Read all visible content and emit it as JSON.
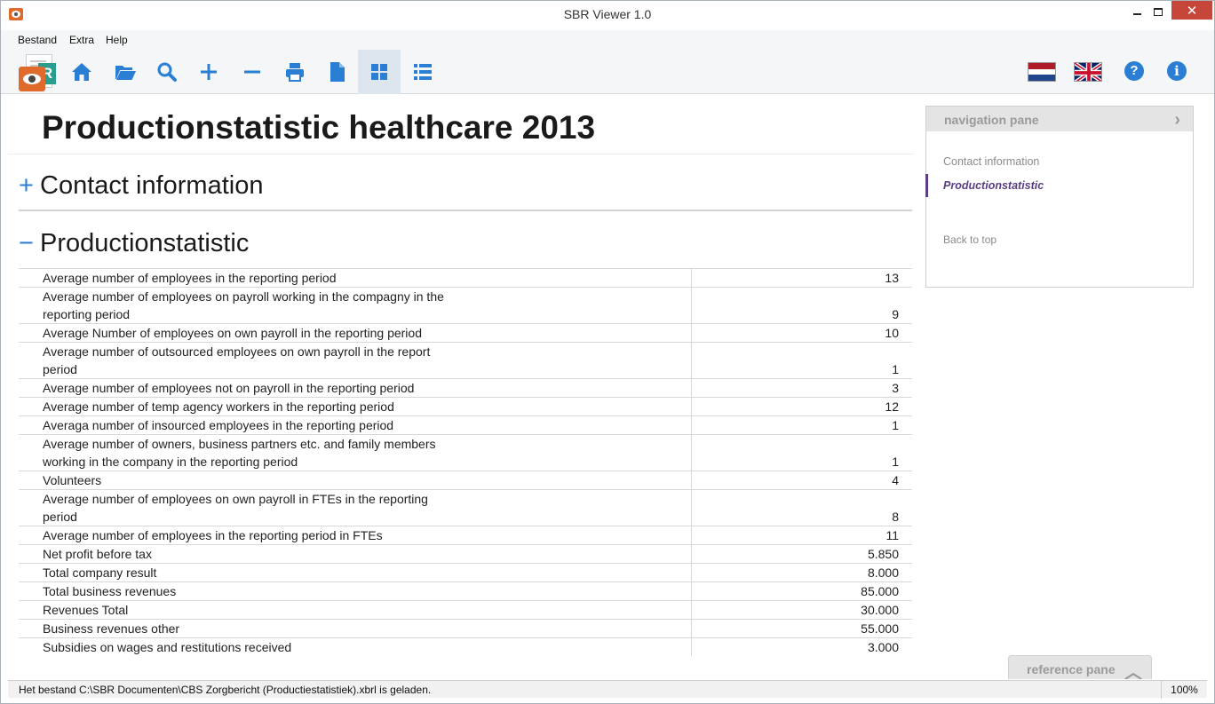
{
  "window": {
    "title": "SBR Viewer 1.0",
    "close_glyph": "✕"
  },
  "menu": [
    "Bestand",
    "Extra",
    "Help"
  ],
  "toolbar": {
    "icons": [
      "home-icon",
      "open-folder-icon",
      "search-icon",
      "zoom-in-icon",
      "zoom-out-icon",
      "print-icon",
      "document-icon",
      "grid-view-icon",
      "list-view-icon"
    ],
    "active": "grid-view-icon",
    "right_icons": [
      "dutch-flag-icon",
      "uk-flag-icon",
      "help-icon",
      "info-icon"
    ],
    "help_glyph": "?",
    "info_glyph": "i"
  },
  "report": {
    "title": "Productionstatistic healthcare 2013",
    "sections": [
      {
        "sign": "+",
        "title": "Contact information"
      },
      {
        "sign": "−",
        "title": "Productionstatistic"
      }
    ],
    "rows": [
      {
        "label": "Average number of employees in the reporting period",
        "value": "13"
      },
      {
        "label": "Average number of employees on payroll working in the compagny in the reporting period",
        "value": "9"
      },
      {
        "label": "Average Number of employees on own payroll in the reporting period",
        "value": "10"
      },
      {
        "label": "Average number of outsourced employees on own payroll in the report period",
        "value": "1"
      },
      {
        "label": "Average number of employees not on payroll in the reporting period",
        "value": "3"
      },
      {
        "label": "Average number of temp agency workers in the reporting period",
        "value": "12"
      },
      {
        "label": "Averaga number of insourced employees in the reporting period",
        "value": "1"
      },
      {
        "label": "Average number of owners, business partners etc. and family members working in the company in the reporting period",
        "value": "1"
      },
      {
        "label": "Volunteers",
        "value": "4"
      },
      {
        "label": "Average number of employees on own payroll in FTEs in the reporting period",
        "value": "8"
      },
      {
        "label": "Average number of employees in the reporting period in FTEs",
        "value": "11"
      },
      {
        "label": "Net profit before tax",
        "value": "5.850"
      },
      {
        "label": "Total company result",
        "value": "8.000"
      },
      {
        "label": "Total business revenues",
        "value": "85.000"
      },
      {
        "label": "Revenues Total",
        "value": "30.000"
      },
      {
        "label": "Business revenues other",
        "value": "55.000"
      },
      {
        "label": "Subsidies on wages and restitutions received",
        "value": "3.000"
      }
    ]
  },
  "navigation_pane": {
    "title": "navigation pane",
    "chevron": "›",
    "items": [
      "Contact information",
      "Productionstatistic"
    ],
    "active_item": "Productionstatistic",
    "back_to_top": "Back to top"
  },
  "reference_pane": {
    "title": "reference pane",
    "chevron": "︿"
  },
  "status": {
    "message": "Het bestand C:\\SBR Documenten\\CBS Zorgbericht (Productiestatistiek).xbrl is geladen.",
    "zoom": "100%"
  },
  "colors": {
    "accent": "#2a7fd4",
    "active_nav": "#5b3e82",
    "close_button": "#c7463a",
    "logo_orange": "#e06a2c",
    "logo_teal": "#2a9d8f"
  }
}
